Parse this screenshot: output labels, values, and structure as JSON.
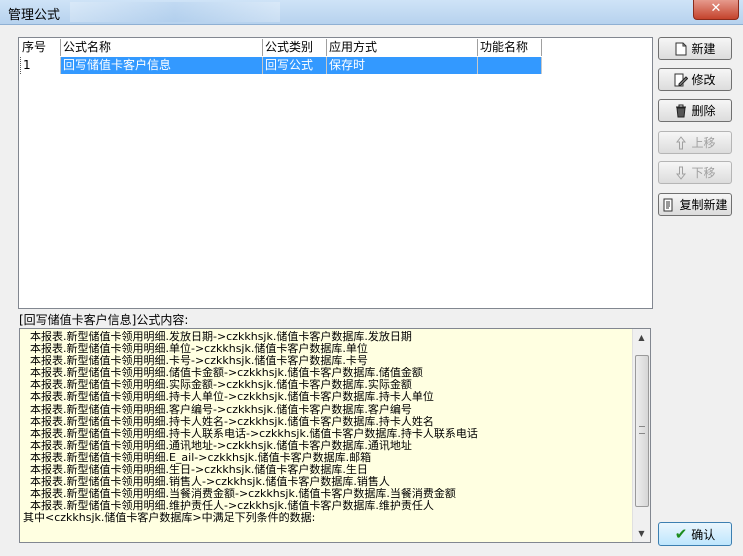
{
  "window": {
    "title": "管理公式",
    "close_glyph": "✕"
  },
  "table": {
    "columns": [
      "序号",
      "公式名称",
      "公式类别",
      "应用方式",
      "功能名称"
    ],
    "rows": [
      [
        "1",
        "回写储值卡客户信息",
        "回写公式",
        "保存时",
        ""
      ]
    ]
  },
  "buttons": {
    "new": "新建",
    "edit": "修改",
    "delete": "删除",
    "up": "上移",
    "down": "下移",
    "copy_new": "复制新建",
    "ok": "确认"
  },
  "content": {
    "label": "[回写储值卡客户信息]公式内容:",
    "lines": [
      "  本报表.新型储值卡领用明细.发放日期->czkkhsjk.储值卡客户数据库.发放日期",
      "  本报表.新型储值卡领用明细.单位->czkkhsjk.储值卡客户数据库.单位",
      "  本报表.新型储值卡领用明细.卡号->czkkhsjk.储值卡客户数据库.卡号",
      "  本报表.新型储值卡领用明细.储值卡金额->czkkhsjk.储值卡客户数据库.储值金额",
      "  本报表.新型储值卡领用明细.实际金额->czkkhsjk.储值卡客户数据库.实际金额",
      "  本报表.新型储值卡领用明细.持卡人单位->czkkhsjk.储值卡客户数据库.持卡人单位",
      "  本报表.新型储值卡领用明细.客户编号->czkkhsjk.储值卡客户数据库.客户编号",
      "  本报表.新型储值卡领用明细.持卡人姓名->czkkhsjk.储值卡客户数据库.持卡人姓名",
      "  本报表.新型储值卡领用明细.持卡人联系电话->czkkhsjk.储值卡客户数据库.持卡人联系电话",
      "  本报表.新型储值卡领用明细.通讯地址->czkkhsjk.储值卡客户数据库.通讯地址",
      "  本报表.新型储值卡领用明细.E_ail->czkkhsjk.储值卡客户数据库.邮箱",
      "  本报表.新型储值卡领用明细.生日->czkkhsjk.储值卡客户数据库.生日",
      "  本报表.新型储值卡领用明细.销售人->czkkhsjk.储值卡客户数据库.销售人",
      "  本报表.新型储值卡领用明细.当餐消费金额->czkkhsjk.储值卡客户数据库.当餐消费金额",
      "  本报表.新型储值卡领用明细.维护责任人->czkkhsjk.储值卡客户数据库.维护责任人",
      "其中<czkkhsjk.储值卡客户数据库>中满足下列条件的数据:"
    ]
  }
}
